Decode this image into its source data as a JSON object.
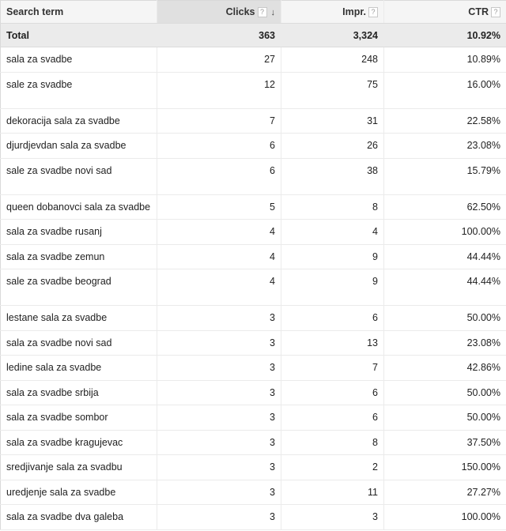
{
  "table": {
    "columns": [
      {
        "label": "Search term",
        "help": false,
        "sorted": false
      },
      {
        "label": "Clicks",
        "help": true,
        "sorted": true,
        "sort_direction": "descending"
      },
      {
        "label": "Impr.",
        "help": true,
        "sorted": false
      },
      {
        "label": "CTR",
        "help": true,
        "sorted": false
      }
    ],
    "help_glyph": "?",
    "sort_glyph": "↓",
    "total": {
      "label": "Total",
      "clicks": "363",
      "impr": "3,324",
      "ctr": "10.92%"
    },
    "rows": [
      {
        "term": "sala za svadbe",
        "clicks": "27",
        "impr": "248",
        "ctr": "10.89%",
        "tall": false
      },
      {
        "term": "sale za svadbe",
        "clicks": "12",
        "impr": "75",
        "ctr": "16.00%",
        "tall": true
      },
      {
        "term": "dekoracija sala za svadbe",
        "clicks": "7",
        "impr": "31",
        "ctr": "22.58%",
        "tall": false
      },
      {
        "term": "djurdjevdan sala za svadbe",
        "clicks": "6",
        "impr": "26",
        "ctr": "23.08%",
        "tall": false
      },
      {
        "term": "sale za svadbe novi sad",
        "clicks": "6",
        "impr": "38",
        "ctr": "15.79%",
        "tall": true
      },
      {
        "term": "queen dobanovci sala za svadbe",
        "clicks": "5",
        "impr": "8",
        "ctr": "62.50%",
        "tall": false
      },
      {
        "term": "sala za svadbe rusanj",
        "clicks": "4",
        "impr": "4",
        "ctr": "100.00%",
        "tall": false
      },
      {
        "term": "sala za svadbe zemun",
        "clicks": "4",
        "impr": "9",
        "ctr": "44.44%",
        "tall": false
      },
      {
        "term": "sale za svadbe beograd",
        "clicks": "4",
        "impr": "9",
        "ctr": "44.44%",
        "tall": true
      },
      {
        "term": "lestane sala za svadbe",
        "clicks": "3",
        "impr": "6",
        "ctr": "50.00%",
        "tall": false
      },
      {
        "term": "sala za svadbe novi sad",
        "clicks": "3",
        "impr": "13",
        "ctr": "23.08%",
        "tall": false
      },
      {
        "term": "ledine sala za svadbe",
        "clicks": "3",
        "impr": "7",
        "ctr": "42.86%",
        "tall": false
      },
      {
        "term": "sala za svadbe srbija",
        "clicks": "3",
        "impr": "6",
        "ctr": "50.00%",
        "tall": false
      },
      {
        "term": "sala za svadbe sombor",
        "clicks": "3",
        "impr": "6",
        "ctr": "50.00%",
        "tall": false
      },
      {
        "term": "sala za svadbe kragujevac",
        "clicks": "3",
        "impr": "8",
        "ctr": "37.50%",
        "tall": false
      },
      {
        "term": "sredjivanje sala za svadbu",
        "clicks": "3",
        "impr": "2",
        "ctr": "150.00%",
        "tall": false
      },
      {
        "term": "uredjenje sala za svadbe",
        "clicks": "3",
        "impr": "11",
        "ctr": "27.27%",
        "tall": false
      },
      {
        "term": "sala za svadbe dva galeba",
        "clicks": "3",
        "impr": "3",
        "ctr": "100.00%",
        "tall": false
      }
    ]
  }
}
